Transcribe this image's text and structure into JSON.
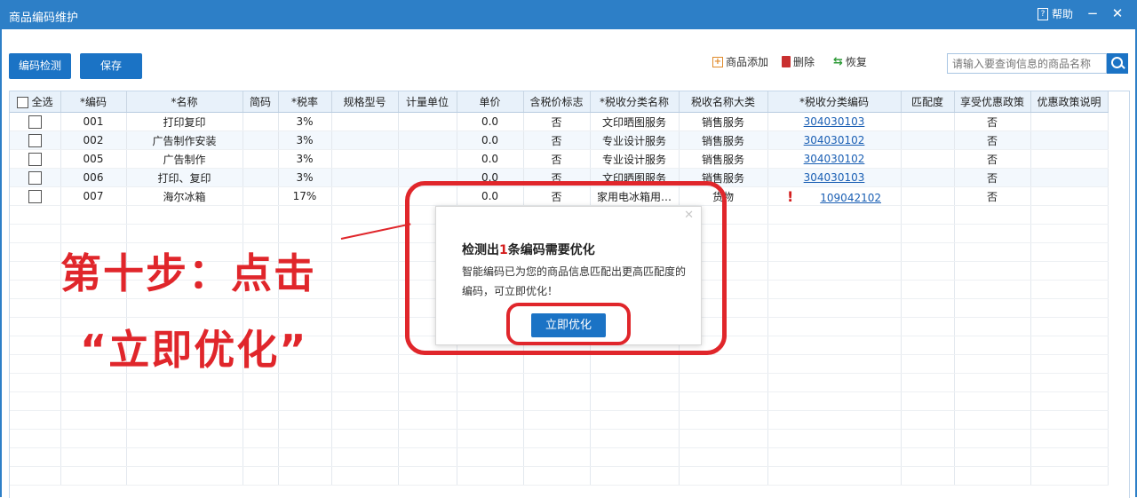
{
  "window": {
    "title": "商品编码维护",
    "help_label": "帮助",
    "help_icon": "?",
    "minimize": "−",
    "close": "✕"
  },
  "toolbar": {
    "check_label": "编码检测",
    "save_label": "保存",
    "add_label": "商品添加",
    "delete_label": "删除",
    "restore_label": "恢复",
    "search_placeholder": "请输入要查询信息的商品名称"
  },
  "table": {
    "columns": [
      "全选",
      "*编码",
      "*名称",
      "简码",
      "*税率",
      "规格型号",
      "计量单位",
      "单价",
      "含税价标志",
      "*税收分类名称",
      "税收名称大类",
      "*税收分类编码",
      "匹配度",
      "享受优惠政策",
      "优惠政策说明"
    ],
    "rows": [
      {
        "code": "001",
        "name": "打印复印",
        "short": "",
        "rate": "3%",
        "spec": "",
        "unit": "",
        "price": "0.0",
        "tax_incl": "否",
        "cat_name": "文印晒图服务",
        "cat_major": "销售服务",
        "cat_code": "304030103",
        "flag": "",
        "match": "",
        "preferential": "否",
        "pref_note": ""
      },
      {
        "code": "002",
        "name": "广告制作安装",
        "short": "",
        "rate": "3%",
        "spec": "",
        "unit": "",
        "price": "0.0",
        "tax_incl": "否",
        "cat_name": "专业设计服务",
        "cat_major": "销售服务",
        "cat_code": "304030102",
        "flag": "",
        "match": "",
        "preferential": "否",
        "pref_note": ""
      },
      {
        "code": "005",
        "name": "广告制作",
        "short": "",
        "rate": "3%",
        "spec": "",
        "unit": "",
        "price": "0.0",
        "tax_incl": "否",
        "cat_name": "专业设计服务",
        "cat_major": "销售服务",
        "cat_code": "304030102",
        "flag": "",
        "match": "",
        "preferential": "否",
        "pref_note": ""
      },
      {
        "code": "006",
        "name": "打印、复印",
        "short": "",
        "rate": "3%",
        "spec": "",
        "unit": "",
        "price": "0.0",
        "tax_incl": "否",
        "cat_name": "文印晒图服务",
        "cat_major": "销售服务",
        "cat_code": "304030103",
        "flag": "",
        "match": "",
        "preferential": "否",
        "pref_note": ""
      },
      {
        "code": "007",
        "name": "海尔冰箱",
        "short": "",
        "rate": "17%",
        "spec": "",
        "unit": "",
        "price": "0.0",
        "tax_incl": "否",
        "cat_name": "家用电冰箱用…",
        "cat_major": "货物",
        "cat_code": "109042102",
        "flag": "!",
        "match": "",
        "preferential": "否",
        "pref_note": ""
      }
    ]
  },
  "annotation": {
    "line1": "第十步：点击",
    "line2": "“立即优化”"
  },
  "popup": {
    "close": "✕",
    "title_prefix": "检测出",
    "title_count": "1",
    "title_suffix": "条编码需要优化",
    "body": "智能编码已为您的商品信息匹配出更高匹配度的编码，可立即优化！",
    "button": "立即优化"
  },
  "colors": {
    "titlebar": "#2d7fc7",
    "primary_button": "#1b73c5",
    "annotation_red": "#e0262b",
    "link": "#1a5fb4"
  }
}
